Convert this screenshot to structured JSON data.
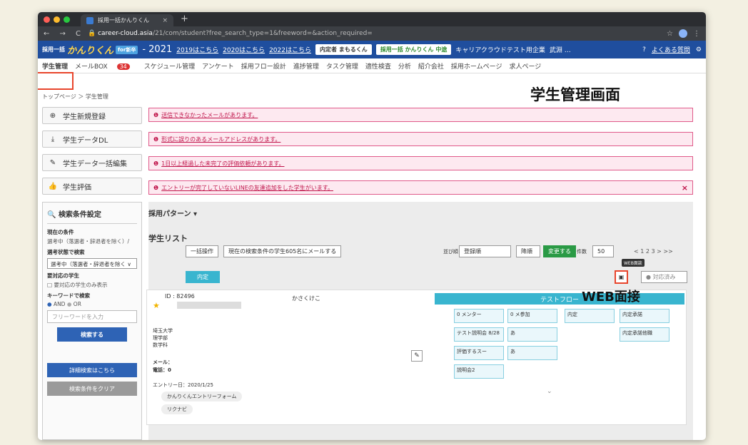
{
  "browser": {
    "tab_title": "採用一括かんりくん",
    "tab_close": "×",
    "new_tab": "+",
    "url_host": "career-cloud.asia",
    "url_path": "/21/com/student?free_search_type=1&freeword=&action_required=",
    "nav_back": "←",
    "nav_forward": "→",
    "nav_reload": "C",
    "star": "☆",
    "menu": "⋮"
  },
  "appbar": {
    "logo_prefix": "採用一括",
    "logo_main": "かんりくん",
    "logo_badge": "for新卒",
    "year": "- 2021",
    "links": [
      "2019はこちら",
      "2020はこちら",
      "2022はこちら"
    ],
    "pill1": "内定者 まもるくん",
    "pill2": "採用一括 かんりくん 中途",
    "company": "キャリアクラウドテスト用企業",
    "user": "武淵 …",
    "faq": "よくある質問",
    "gear": "⚙"
  },
  "menu": {
    "items": [
      "学生管理",
      "メールBOX",
      "スケジュール管理",
      "アンケート",
      "採用フロー設計",
      "進捗管理",
      "タスク管理",
      "適性検査",
      "分析",
      "紹介会社",
      "採用ホームページ",
      "求人ページ"
    ],
    "mail_badge": "34"
  },
  "breadcrumb": "トップページ ＞ 学生管理",
  "annotations": {
    "screen_label": "学生管理画面",
    "web_label": "WEB面接",
    "web_tooltip": "WEB面談"
  },
  "sidebar": {
    "buttons": [
      "学生新規登録",
      "学生データDL",
      "学生データ一括編集",
      "学生評価"
    ]
  },
  "alerts": [
    "送信できなかったメールがあります。",
    "形式に誤りのあるメールアドレスがあります。",
    "1日以上経過した未完了の評価依頼があります。",
    "エントリーが完了していないLINEの友達追加をした学生がいます。"
  ],
  "search": {
    "title": "検索条件設定",
    "current_label": "現在の条件",
    "current_value": "選考中（落選者・辞退者を除く）/",
    "status_label": "選考状態で検索",
    "status_select": "選考中（落選者・辞退者を除く ∨",
    "target_label": "要対応の学生",
    "target_check": "要対応の学生のみ表示",
    "keyword_label": "キーワードで検索",
    "and": "AND",
    "or": "OR",
    "free_placeholder": "フリーワードを入力",
    "search_btn": "検索する",
    "detail_btn": "詳細検索はこちら",
    "clear_btn": "検索条件をクリア"
  },
  "main": {
    "pattern_label": "採用パターン",
    "list_title": "学生リスト",
    "bulk_btn": "一括操作",
    "mail_btn": "現在の検索条件の学生605名にメールする",
    "sort_label": "並び順",
    "sort_select": "登録順",
    "order_select": "降順",
    "change_btn": "変更する",
    "count_label": "件数",
    "count_select": "50",
    "pager": "< 1 2 3 > >>",
    "status_tag": "内定",
    "done_select": "● 対応済み"
  },
  "student": {
    "id": "ID : 82496",
    "kana": "かさくけこ",
    "school": "埼玉大学",
    "faculty": "理学部",
    "dept": "数学科",
    "mail_label": "メール：",
    "tel_label": "電話：0",
    "entry": "エントリー日：2020/1/25",
    "form": "かんりくんエントリーフォーム",
    "media": "リクナビ"
  },
  "flow": {
    "title": "テストフロー",
    "cells": [
      "0 メンター",
      "0 メ参加",
      "内定",
      "内定承諾",
      "テスト説明会 8/28",
      "あ",
      "内定承諾他職",
      "評価するスー",
      "あ",
      "説明会2"
    ]
  }
}
